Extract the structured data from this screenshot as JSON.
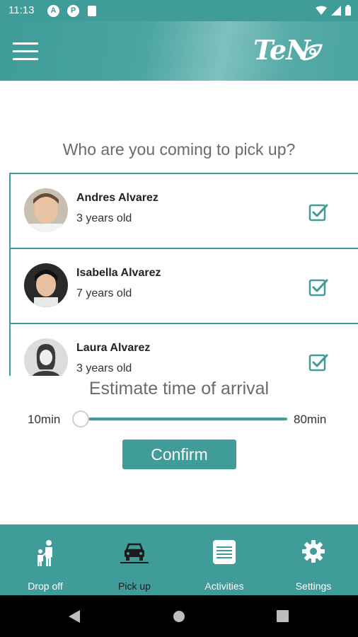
{
  "status_bar": {
    "time": "11:13"
  },
  "header": {
    "logo_text": "TeN"
  },
  "heading": "Who are you coming to pick up?",
  "children": [
    {
      "name": "Andres Alvarez",
      "age": "3 years old",
      "checked": true
    },
    {
      "name": "Isabella Alvarez",
      "age": "7 years old",
      "checked": true
    },
    {
      "name": "Laura Alvarez",
      "age": "3 years old",
      "checked": true
    }
  ],
  "eta": {
    "title": "Estimate time of arrival",
    "min_label": "10min",
    "max_label": "80min",
    "value_fraction": 0
  },
  "confirm_label": "Confirm",
  "bottom_nav": [
    {
      "label": "Drop off",
      "icon": "parent-child-icon",
      "active": false
    },
    {
      "label": "Pick up",
      "icon": "car-icon",
      "active": true
    },
    {
      "label": "Activities",
      "icon": "list-icon",
      "active": false
    },
    {
      "label": "Settings",
      "icon": "gear-icon",
      "active": false
    }
  ],
  "colors": {
    "primary": "#3f9c99",
    "active_tab": "#1b1b1b"
  }
}
